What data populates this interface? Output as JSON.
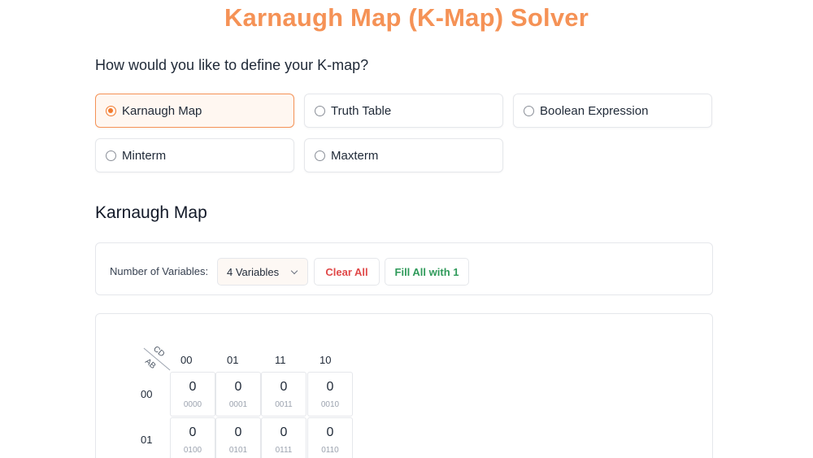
{
  "title": "Karnaugh Map (K-Map) Solver",
  "question": "How would you like to define your K-map?",
  "options": [
    {
      "label": "Karnaugh Map",
      "selected": true
    },
    {
      "label": "Truth Table",
      "selected": false
    },
    {
      "label": "Boolean Expression",
      "selected": false
    },
    {
      "label": "Minterm",
      "selected": false
    },
    {
      "label": "Maxterm",
      "selected": false
    }
  ],
  "section_title": "Karnaugh Map",
  "controls": {
    "variables_label": "Number of Variables:",
    "variables_value": "4 Variables",
    "clear_label": "Clear All",
    "fill_label": "Fill All with 1"
  },
  "kmap": {
    "corner_cols": "CD",
    "corner_rows": "AB",
    "col_headers": [
      "00",
      "01",
      "11",
      "10"
    ],
    "row_headers": [
      "00",
      "01"
    ],
    "cells": [
      [
        {
          "value": "0",
          "bits": "0000"
        },
        {
          "value": "0",
          "bits": "0001"
        },
        {
          "value": "0",
          "bits": "0011"
        },
        {
          "value": "0",
          "bits": "0010"
        }
      ],
      [
        {
          "value": "0",
          "bits": "0100"
        },
        {
          "value": "0",
          "bits": "0101"
        },
        {
          "value": "0",
          "bits": "0111"
        },
        {
          "value": "0",
          "bits": "0110"
        }
      ]
    ]
  },
  "colors": {
    "accent": "#f59256",
    "clear": "#e04848",
    "fill": "#2f9a5a"
  }
}
